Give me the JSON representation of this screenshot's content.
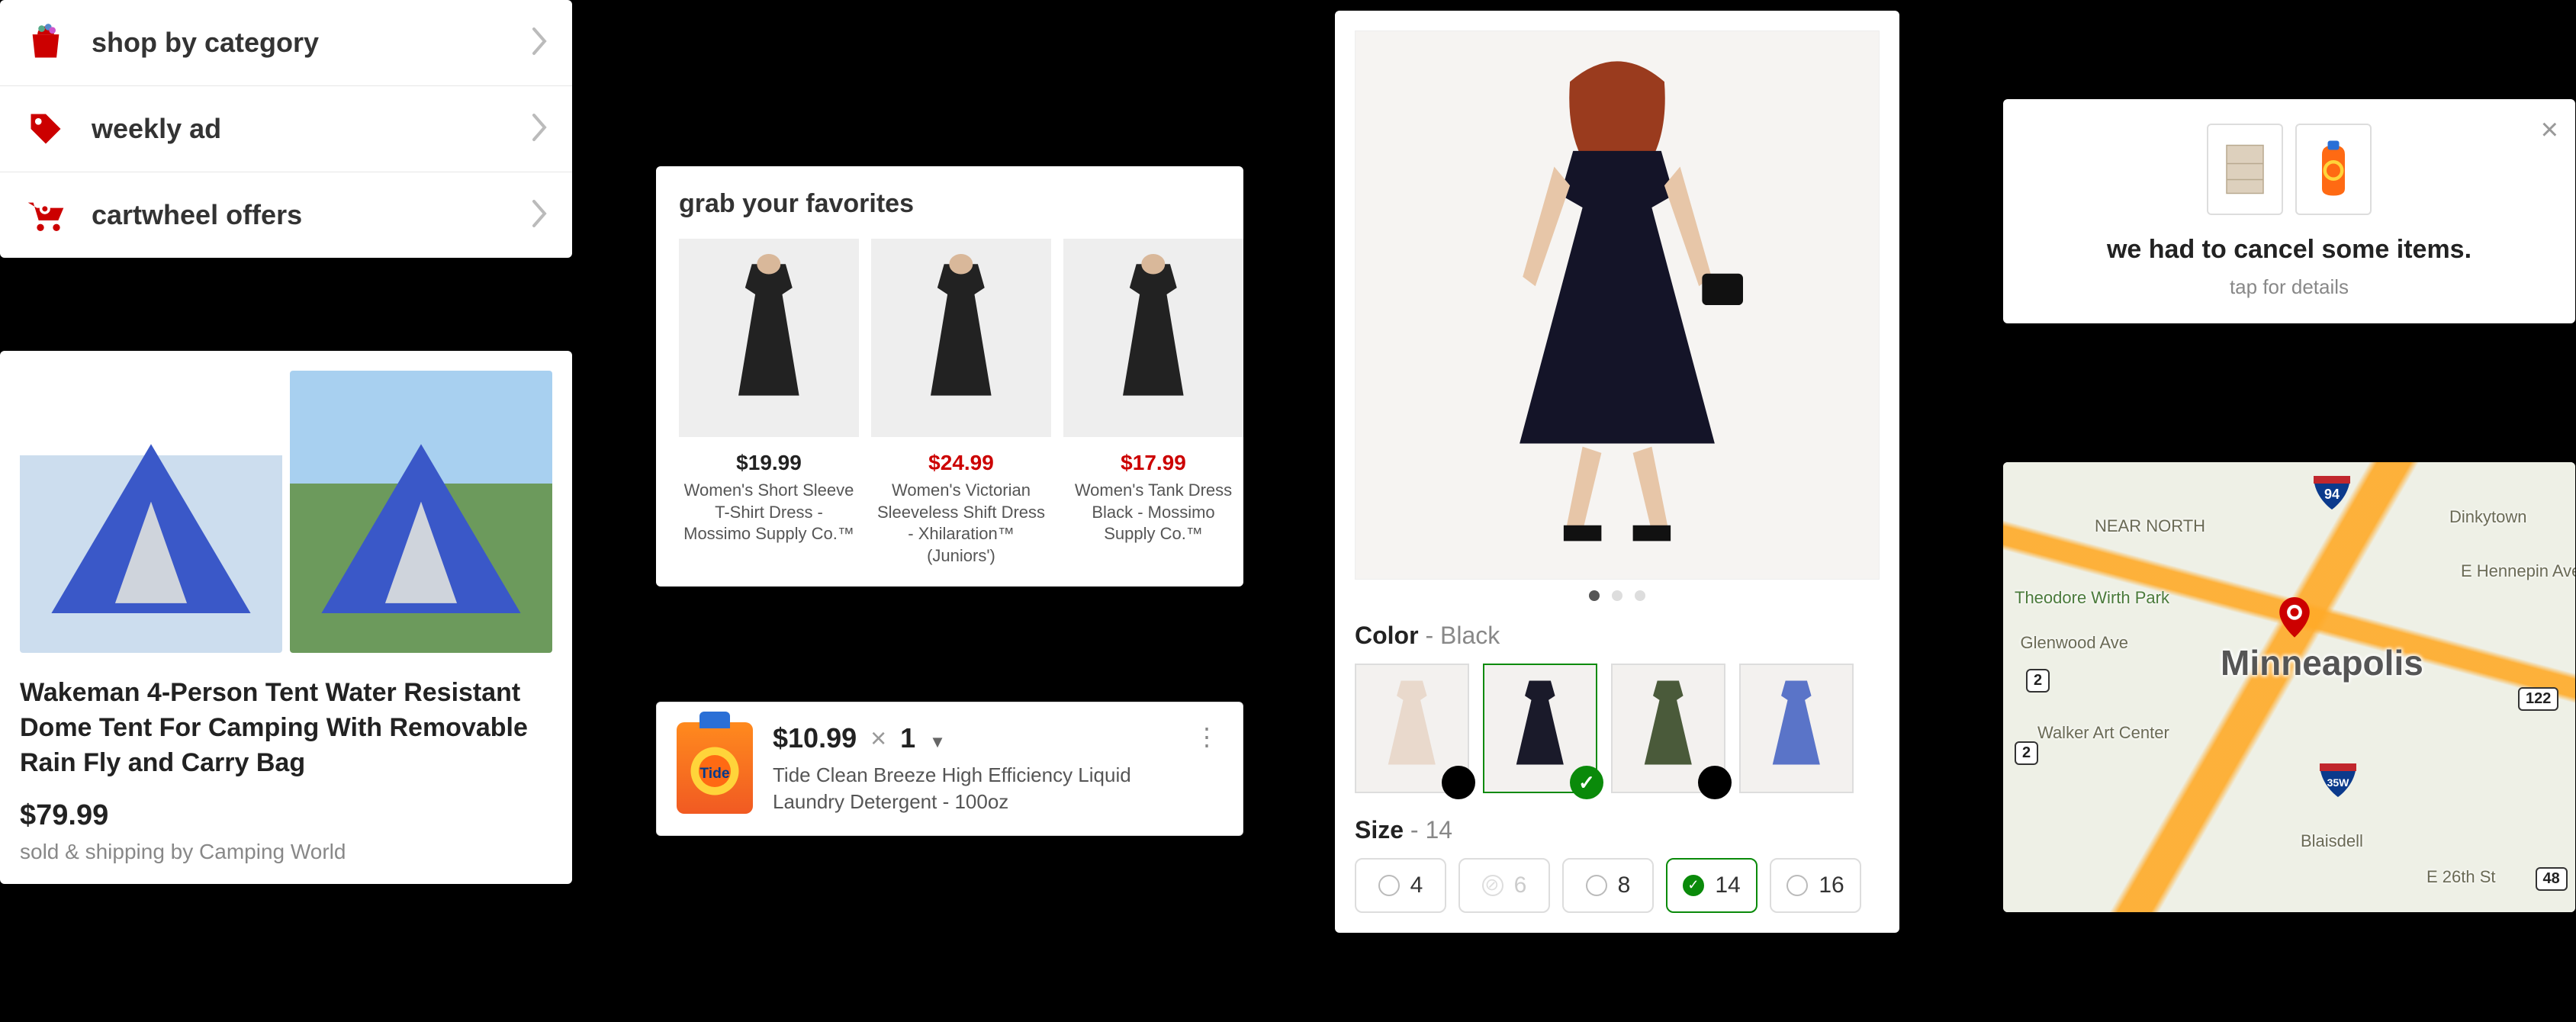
{
  "menu": {
    "items": [
      {
        "label": "shop by category",
        "icon": "shopping-bag"
      },
      {
        "label": "weekly ad",
        "icon": "price-tag"
      },
      {
        "label": "cartwheel offers",
        "icon": "cart"
      }
    ]
  },
  "tent": {
    "title": "Wakeman 4-Person Tent Water Resistant Dome Tent For Camping With Removable Rain Fly and Carry Bag",
    "price": "$79.99",
    "seller": "sold & shipping by Camping World"
  },
  "favorites": {
    "title": "grab your favorites",
    "items": [
      {
        "price": "$19.99",
        "price_color": "black",
        "name": "Women's Short Sleeve T-Shirt Dress - Mossimo Supply Co.™"
      },
      {
        "price": "$24.99",
        "price_color": "red",
        "name": "Women's Victorian Sleeveless Shift Dress - Xhilaration™ (Juniors')"
      },
      {
        "price": "$17.99",
        "price_color": "red",
        "name": "Women's Tank Dress Black - Mossimo Supply Co.™"
      }
    ]
  },
  "cart_item": {
    "price": "$10.99",
    "multiply": "×",
    "qty": "1",
    "name": "Tide Clean Breeze High Efficiency Liquid Laundry Detergent - 100oz"
  },
  "pdp": {
    "color_label": "Color",
    "color_value": "Black",
    "size_label": "Size",
    "size_value": "14",
    "separator": " - ",
    "swatches": [
      {
        "dot": "black",
        "selected": false,
        "tint": "#e9d9cc"
      },
      {
        "dot": null,
        "selected": true,
        "tint": "#1a1a2a"
      },
      {
        "dot": "black",
        "selected": false,
        "tint": "#4a5a3a"
      },
      {
        "dot": null,
        "selected": false,
        "tint": "#5a74c8"
      }
    ],
    "sizes": [
      {
        "label": "4",
        "state": "available"
      },
      {
        "label": "6",
        "state": "disabled"
      },
      {
        "label": "8",
        "state": "available"
      },
      {
        "label": "14",
        "state": "selected"
      },
      {
        "label": "16",
        "state": "available"
      }
    ]
  },
  "cancel": {
    "title": "we had to cancel some items.",
    "subtitle": "tap for details"
  },
  "map": {
    "city": "Minneapolis",
    "labels": {
      "near_north": "NEAR NORTH",
      "wirth": "Theodore Wirth Park",
      "glenwood": "Glenwood Ave",
      "walker": "Walker Art Center",
      "dinkytown": "Dinkytown",
      "hamm": "E Hennepin Ave",
      "blaisdell": "Blaisdell",
      "e26": "E 26th St"
    },
    "shields": {
      "r2a": "2",
      "r2b": "2",
      "r122": "122",
      "r48": "48",
      "i94": "94",
      "i35w": "35W"
    }
  },
  "colors": {
    "brand_red": "#cc0000",
    "select_green": "#0a8a0a"
  }
}
